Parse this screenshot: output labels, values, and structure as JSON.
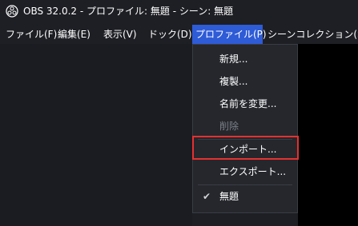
{
  "titlebar": {
    "title": "OBS 32.0.2 - プロファイル: 無題 - シーン: 無題",
    "icon": "obs-logo-icon"
  },
  "menubar": {
    "items": [
      {
        "label": "ファイル(F)"
      },
      {
        "label": "編集(E)"
      },
      {
        "label": "表示(V)"
      },
      {
        "label": "ドック(D)"
      },
      {
        "label": "プロファイル(P)"
      },
      {
        "label": "シーンコレクション(S)"
      }
    ],
    "active": "プロファイル(P)"
  },
  "profile_menu": {
    "items": [
      {
        "label": "新規..."
      },
      {
        "label": "複製..."
      },
      {
        "label": "名前を変更..."
      },
      {
        "label": "削除",
        "disabled": true
      },
      {
        "label": "インポート...",
        "highlighted": true
      },
      {
        "label": "エクスポート..."
      },
      {
        "label": "無題",
        "checked": true
      }
    ]
  },
  "colors": {
    "background": "#1e1f24",
    "menu_active": "#2e5bd6",
    "highlight_border": "#e5312f",
    "disabled_text": "#7d8088"
  }
}
